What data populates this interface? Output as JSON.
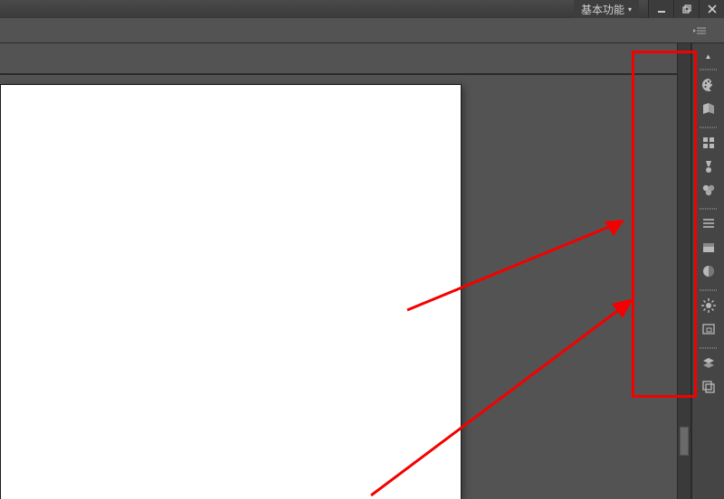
{
  "titlebar": {
    "workspace_label": "基本功能",
    "minimize": "minimize",
    "maximize": "restore",
    "close": "close"
  },
  "panels": {
    "collapse_tooltip": "Collapse to Icons",
    "groups": [
      {
        "items": [
          {
            "name": "color-panel-icon",
            "tooltip": "颜色"
          },
          {
            "name": "swatches-panel-icon",
            "tooltip": "色板"
          }
        ]
      },
      {
        "items": [
          {
            "name": "libraries-panel-icon",
            "tooltip": "库"
          },
          {
            "name": "brushes-panel-icon",
            "tooltip": "画笔"
          },
          {
            "name": "styles-panel-icon",
            "tooltip": "样式"
          }
        ]
      },
      {
        "items": [
          {
            "name": "paragraph-panel-icon",
            "tooltip": "段落"
          },
          {
            "name": "character-panel-icon",
            "tooltip": "字符"
          },
          {
            "name": "adjustments-panel-icon",
            "tooltip": "调整"
          }
        ]
      },
      {
        "items": [
          {
            "name": "navigator-panel-icon",
            "tooltip": "导航器"
          },
          {
            "name": "histogram-panel-icon",
            "tooltip": "直方图"
          }
        ]
      },
      {
        "items": [
          {
            "name": "layers-panel-icon",
            "tooltip": "图层"
          },
          {
            "name": "channels-panel-icon",
            "tooltip": "通道"
          }
        ]
      }
    ]
  },
  "annotations": {
    "color": "#f40000"
  }
}
